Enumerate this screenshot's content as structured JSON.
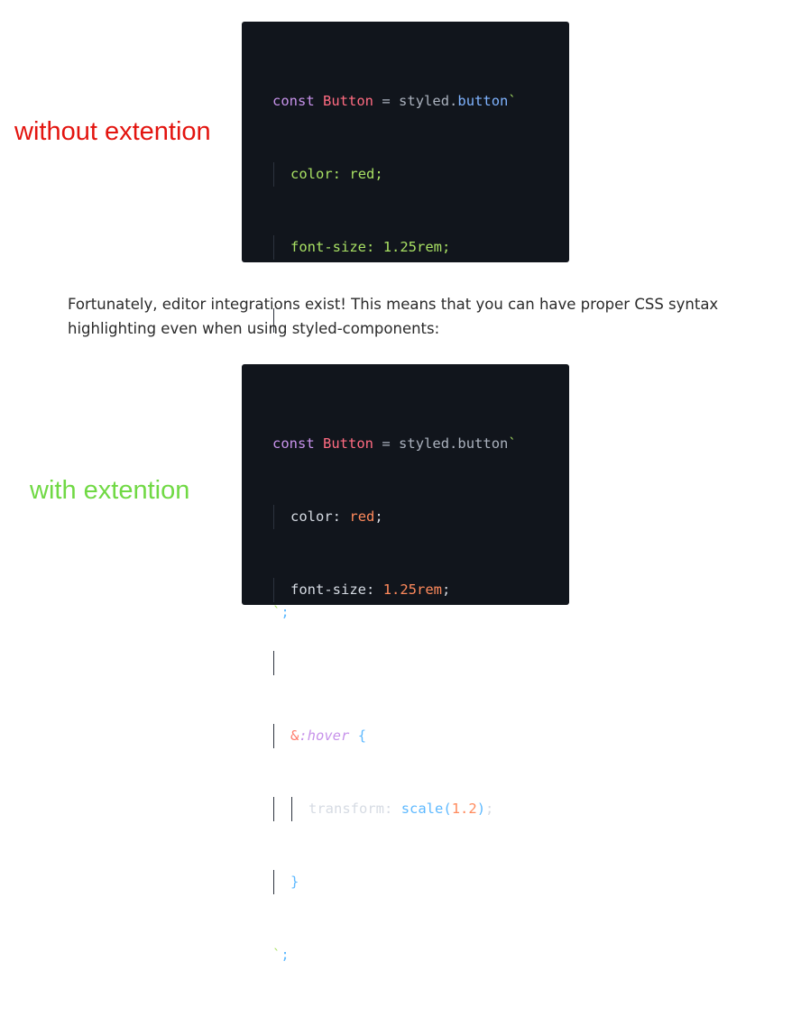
{
  "labels": {
    "without": "without extention",
    "with": "with extention"
  },
  "paragraph": "Fortunately, editor integrations exist! This means that you can have proper CSS syntax highlighting even when using styled-components:",
  "code": {
    "kw": "const",
    "name": "Button",
    "eq": "=",
    "obj": "styled",
    "dot": ".",
    "tag": "button",
    "tick": "`",
    "color_prop": "color",
    "color_val": "red",
    "size_prop": "font-size",
    "size_val": "1.25rem",
    "amp": "&",
    "pseudo": ":hover",
    "brace_open": "{",
    "transform_prop": "transform",
    "fn": "scale",
    "paren_open": "(",
    "num": "1.2",
    "paren_close": ")",
    "brace_close": "}",
    "colon": ":",
    "semi": ";"
  },
  "colors": {
    "code_background": "#11151c",
    "label_without": "#e3140f",
    "label_with": "#70d944"
  }
}
